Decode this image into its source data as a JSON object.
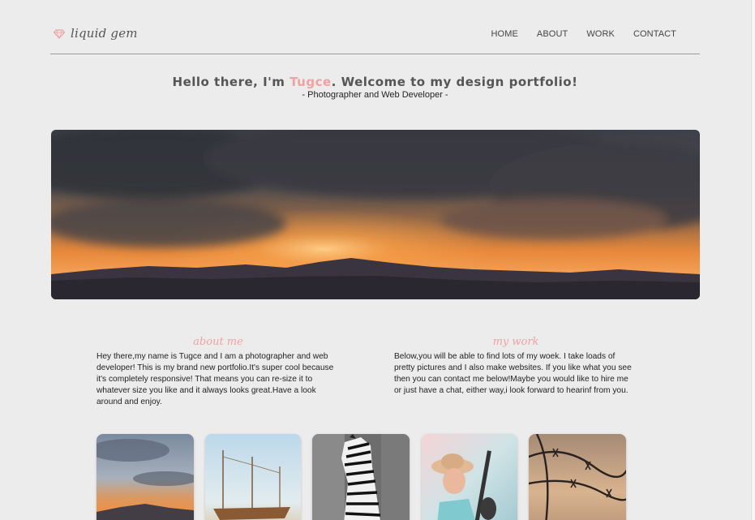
{
  "header": {
    "logo_text": "liquid gem",
    "nav": [
      "HOME",
      "ABOUT",
      "WORK",
      "CONTACT"
    ]
  },
  "hero": {
    "greeting_before": "Hello there, I'm ",
    "name": "Tugce",
    "greeting_after": ". Welcome to my design portfolio!",
    "tagline": "- Photographer and Web Developer -"
  },
  "about": {
    "title": "about me",
    "text": "Hey there,my name is Tugce and I am a photographer and web developer! This is my brand new portfolio.It's super cool because it's completely responsive! That means you can re-size it to whatever size you like and it always looks great.Have a look around and enjoy."
  },
  "work": {
    "title": "my work",
    "text": "Below,you will be able to find lots of my woek. I take loads of pretty pictures and I also make websites. If you like what you see then you can contact me below!Maybe you would like to hire me or just have a chat, either way,i look forward to hearinf from you."
  },
  "colors": {
    "accent": "#f2a1a1",
    "background": "#ececec",
    "rule": "#9a9a9a"
  },
  "icons": {
    "logo": "diamond-gem-icon"
  },
  "thumbnails": [
    "sunset-photo",
    "ship-photo",
    "zebra-photo",
    "guitarist-photo",
    "barbed-wire-photo"
  ]
}
